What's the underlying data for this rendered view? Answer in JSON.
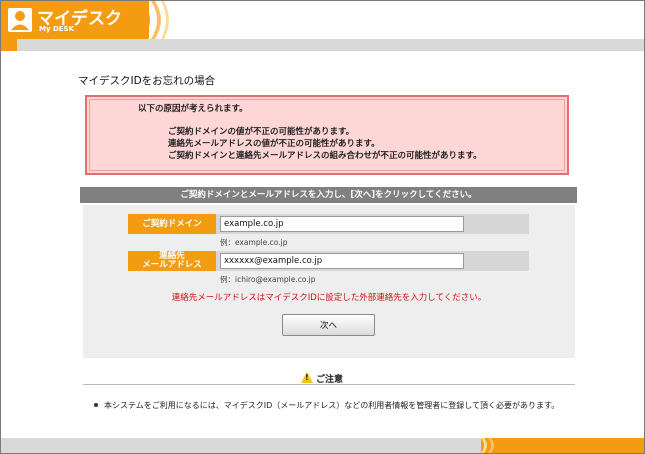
{
  "header": {
    "app_title": "マイデスク",
    "app_subtitle": "My DESK"
  },
  "page": {
    "title": "マイデスクIDをお忘れの場合"
  },
  "error": {
    "heading": "以下の原因が考えられます。",
    "lines": [
      "ご契約ドメインの値が不正の可能性があります。",
      "連絡先メールアドレスの値が不正の可能性があります。",
      "ご契約ドメインと連絡先メールアドレスの組み合わせが不正の可能性があります。"
    ]
  },
  "instruction": "ご契約ドメインとメールアドレスを入力し、[次へ]をクリックしてください。",
  "form": {
    "domain_label": "ご契約ドメイン",
    "domain_value": "example.co.jp",
    "domain_example": "例：example.co.jp",
    "email_label_line1": "連絡先",
    "email_label_line2": "メールアドレス",
    "email_value": "xxxxxx@example.co.jp",
    "email_example": "例：ichiro@example.co.jp",
    "warning": "連絡先メールアドレスはマイデスクIDに設定した外部連絡先を入力してください。",
    "next_label": "次へ"
  },
  "caution": {
    "title": "ご注意",
    "note": "本システムをご利用になるには、マイデスクID（メールアドレス）などの利用者情報を管理者に登録して頂く必要があります。"
  },
  "colors": {
    "brand_orange": "#f39c12",
    "error_bg": "#ffd6d6",
    "error_border": "#e56d6d",
    "warning_red": "#d01010"
  }
}
